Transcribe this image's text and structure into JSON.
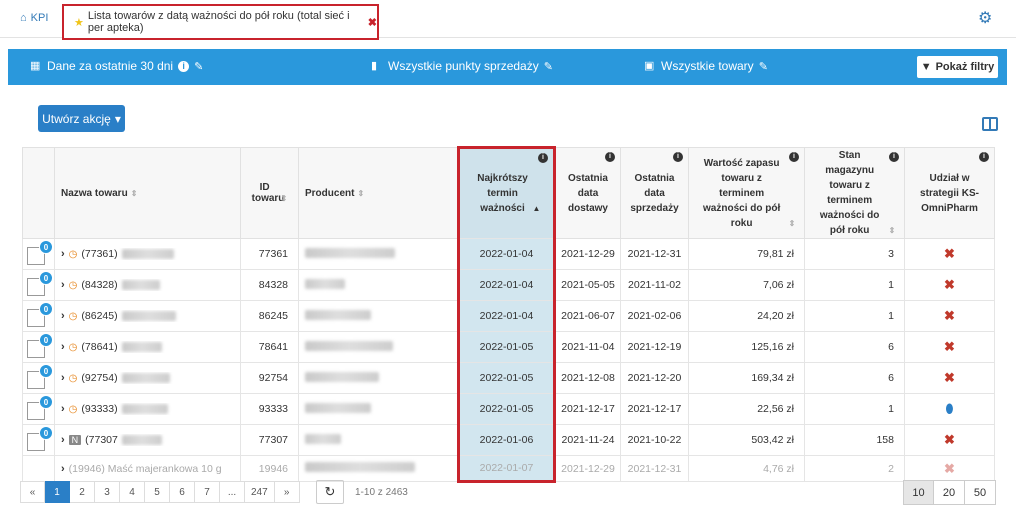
{
  "tabs": {
    "kpi_label": "KPI",
    "active_label": "Lista towarów z datą ważności do pół roku (total sieć i per apteka)",
    "close_symbol": "✖"
  },
  "filterbar": {
    "period": "Dane za ostatnie 30 dni",
    "points": "Wszystkie punkty sprzedaży",
    "goods": "Wszystkie towary",
    "show_filters": "Pokaż filtry"
  },
  "action_button": "Utwórz akcję",
  "columns": {
    "name": "Nazwa towaru",
    "id": "ID towaru",
    "producer": "Producent",
    "expiry": "Najkrótszy termin ważności",
    "last_delivery": "Ostatnia data dostawy",
    "last_sale": "Ostatnia data sprzedaży",
    "stock_value": "Wartość zapasu towaru z terminem ważności do pół roku",
    "stock_qty": "Stan magazynu towaru z terminem ważności do pół roku",
    "strategy": "Udział w strategii KS-OmniPharm"
  },
  "rows": [
    {
      "badge": "0",
      "name_prefix": "(77361)",
      "id": "77361",
      "expiry": "2022-01-04",
      "last_delivery": "2021-12-29",
      "last_sale": "2021-12-31",
      "value": "79,81 zł",
      "qty": "3",
      "strategy": "✖"
    },
    {
      "badge": "0",
      "name_prefix": "(84328)",
      "id": "84328",
      "expiry": "2022-01-04",
      "last_delivery": "2021-05-05",
      "last_sale": "2021-11-02",
      "value": "7,06 zł",
      "qty": "1",
      "strategy": "✖"
    },
    {
      "badge": "0",
      "name_prefix": "(86245)",
      "id": "86245",
      "expiry": "2022-01-04",
      "last_delivery": "2021-06-07",
      "last_sale": "2021-02-06",
      "value": "24,20 zł",
      "qty": "1",
      "strategy": "✖"
    },
    {
      "badge": "0",
      "name_prefix": "(78641)",
      "id": "78641",
      "expiry": "2022-01-05",
      "last_delivery": "2021-11-04",
      "last_sale": "2021-12-19",
      "value": "125,16 zł",
      "qty": "6",
      "strategy": "✖"
    },
    {
      "badge": "0",
      "name_prefix": "(92754)",
      "id": "92754",
      "expiry": "2022-01-05",
      "last_delivery": "2021-12-08",
      "last_sale": "2021-12-20",
      "value": "169,34 zł",
      "qty": "6",
      "strategy": "✖"
    },
    {
      "badge": "0",
      "name_prefix": "(93333)",
      "id": "93333",
      "expiry": "2022-01-05",
      "last_delivery": "2021-12-17",
      "last_sale": "2021-12-17",
      "value": "22,56 zł",
      "qty": "1",
      "strategy": "pill"
    },
    {
      "badge": "0",
      "name_prefix": "(77307",
      "id": "77307",
      "expiry": "2022-01-06",
      "last_delivery": "2021-11-24",
      "last_sale": "2021-10-22",
      "value": "503,42 zł",
      "qty": "158",
      "strategy": "✖"
    },
    {
      "badge": "0",
      "name_prefix": "(19946) Maść majerankowa 10 g",
      "id": "19946",
      "expiry": "2022-01-07",
      "last_delivery": "2021-12-29",
      "last_sale": "2021-12-31",
      "value": "4,76 zł",
      "qty": "2",
      "strategy": "✖"
    }
  ],
  "pager": {
    "prev": "«",
    "pages": [
      "1",
      "2",
      "3",
      "4",
      "5",
      "6",
      "7",
      "...",
      "247"
    ],
    "next": "»",
    "range": "1-10 z 2463",
    "per_page": [
      "10",
      "20",
      "50"
    ]
  },
  "icons": {
    "home": "home-icon",
    "settings": "gears-icon",
    "calendar": "calendar-icon",
    "building": "building-icon",
    "briefcase": "briefcase-icon",
    "filter": "filter-icon",
    "refresh": "refresh-icon",
    "columns": "columns-icon"
  },
  "colors": {
    "accent": "#2a98dc",
    "highlight_border": "#c8232c",
    "highlight_column": "#d2e6ef",
    "cross": "#c0392b"
  }
}
